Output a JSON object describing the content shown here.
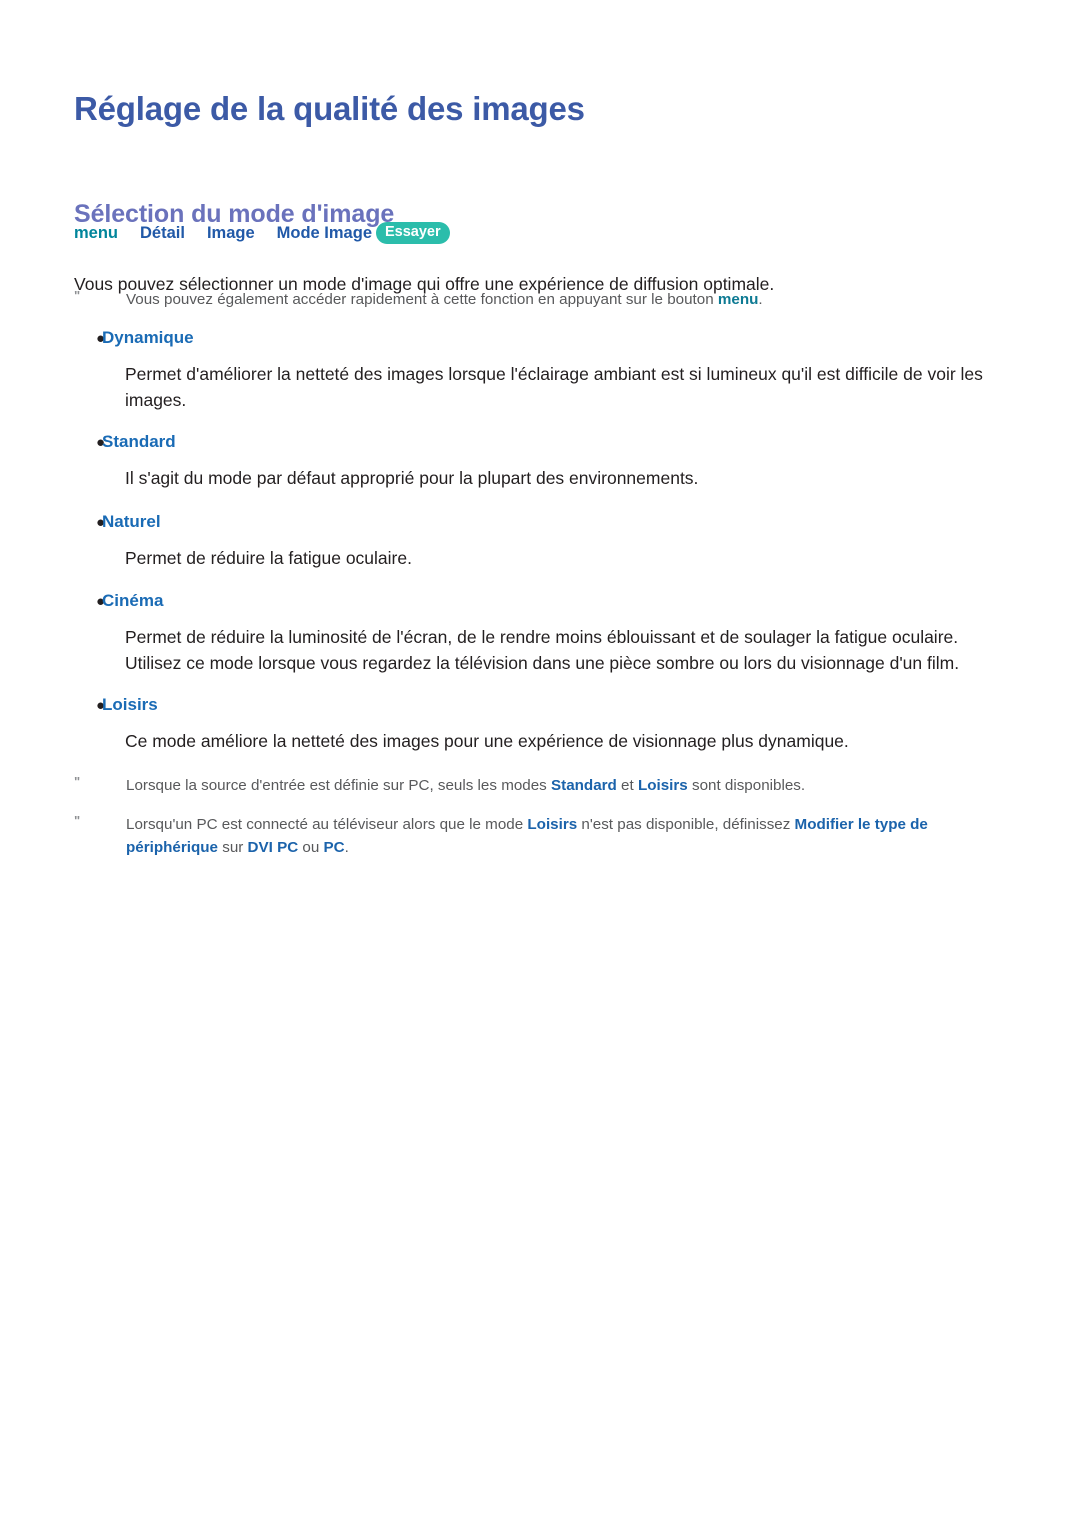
{
  "document": {
    "title": "Réglage de la qualité des images",
    "section_title": "Sélection du mode d'image"
  },
  "breadcrumb": {
    "items": [
      {
        "label": "menu",
        "style": "teal"
      },
      {
        "label": "Détail",
        "style": "blue"
      },
      {
        "label": "Image",
        "style": "blue"
      },
      {
        "label": "Mode Image",
        "style": "blue"
      }
    ],
    "action_badge": "Essayer"
  },
  "lead_paragraph": "Vous pouvez sélectionner un mode d'image qui offre une expérience de diffusion optimale.",
  "notes": {
    "mark": "\"",
    "intro": {
      "text_before": "Vous pouvez également accéder rapidement à cette fonction en appuyant sur le bouton ",
      "emphasis": "menu",
      "text_after": "."
    },
    "pc_modes": {
      "part1": "Lorsque la source d'entrée est définie sur PC, seuls les modes ",
      "bold1": "Standard",
      "part2": " et ",
      "bold2": "Loisirs",
      "part3": " sont disponibles."
    },
    "pc_connected": {
      "part1": "Lorsqu'un PC est connecté au téléviseur alors que le mode ",
      "bold1": "Loisirs",
      "part2": " n'est pas disponible, définissez ",
      "bold2": "Modifier le type de périphérique",
      "part3": " sur ",
      "bold3": "DVI PC",
      "part4": " ou ",
      "bold4": "PC",
      "part5": "."
    }
  },
  "modes": [
    {
      "label": "Dynamique",
      "description": "Permet d'améliorer la netteté des images lorsque l'éclairage ambiant est si lumineux qu'il est difficile de voir les images."
    },
    {
      "label": "Standard",
      "description": "Il s'agit du mode par défaut approprié pour la plupart des environnements."
    },
    {
      "label": "Naturel",
      "description": "Permet de réduire la fatigue oculaire."
    },
    {
      "label": "Cinéma",
      "description": "Permet de réduire la luminosité de l'écran, de le rendre moins éblouissant et de soulager la fatigue oculaire. Utilisez ce mode lorsque vous regardez la télévision dans une pièce sombre ou lors du visionnage d'un film."
    },
    {
      "label": "Loisirs",
      "description": "Ce mode améliore la netteté des images pour une expérience de visionnage plus dynamique."
    }
  ],
  "bullet_glyph": "●",
  "colors": {
    "page_title": "#3c5aa6",
    "section_title": "#6a72bc",
    "accent_blue": "#1a6bb5",
    "accent_teal": "#00859b",
    "badge_teal": "#2bbdab",
    "body_text": "#231f20",
    "note_text": "#58595b",
    "background": "#ffffff"
  }
}
